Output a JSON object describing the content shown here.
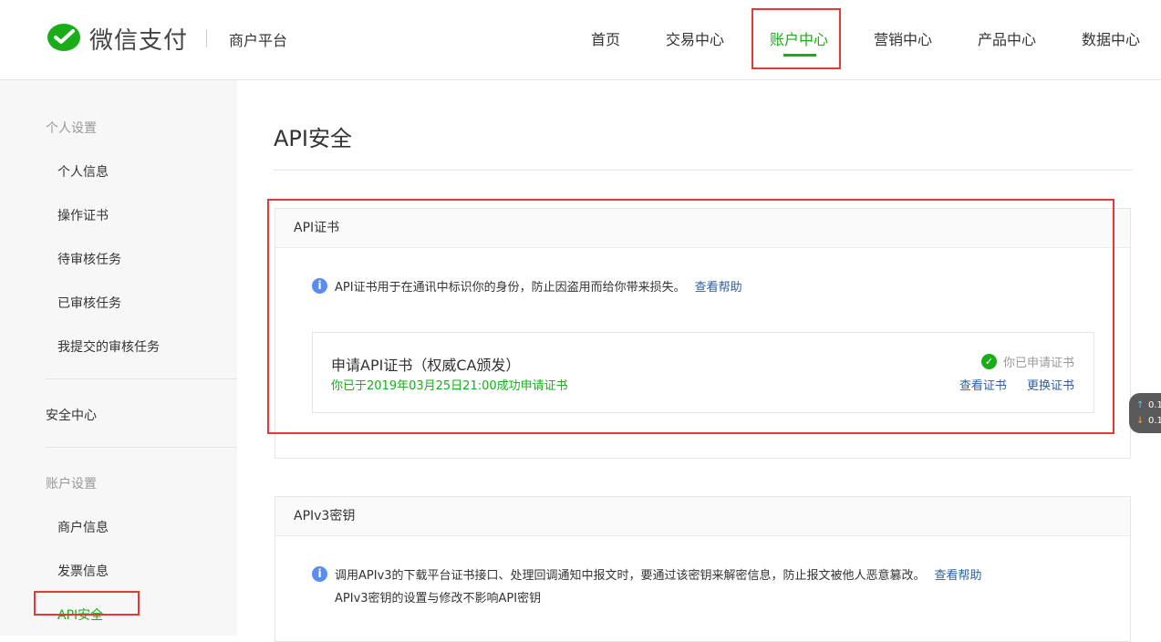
{
  "brand": {
    "name": "微信支付",
    "platform": "商户平台"
  },
  "nav": {
    "items": [
      "首页",
      "交易中心",
      "账户中心",
      "营销中心",
      "产品中心",
      "数据中心"
    ],
    "active": "账户中心"
  },
  "sidebar": {
    "personal_group": "个人设置",
    "personal_items": [
      "个人信息",
      "操作证书",
      "待审核任务",
      "已审核任务",
      "我提交的审核任务"
    ],
    "security_center": "安全中心",
    "account_group": "账户设置",
    "account_items": [
      "商户信息",
      "发票信息",
      "API安全"
    ],
    "active": "API安全"
  },
  "page": {
    "title": "API安全"
  },
  "api_cert": {
    "header": "API证书",
    "info": "API证书用于在通讯中标识你的身份，防止因盗用而给你带来损失。",
    "help": "查看帮助",
    "card_title": "申请API证书（权威CA颁发）",
    "card_sub": "你已于2019年03月25日21:00成功申请证书",
    "status": "你已申请证书",
    "view": "查看证书",
    "replace": "更换证书"
  },
  "apiv3": {
    "header": "APIv3密钥",
    "info_line1": "调用APIv3的下载平台证书接口、处理回调通知中报文时，要通过该密钥来解密信息，防止报文被他人恶意篡改。",
    "help": "查看帮助",
    "info_line2": "APIv3密钥的设置与修改不影响API密钥"
  },
  "widget": {
    "v1": "0.1",
    "v2": "0.1"
  },
  "colors": {
    "brand_green": "#1aad19",
    "link_blue": "#2f5f99",
    "highlight_red": "#e53935",
    "info_blue": "#5b8def"
  }
}
